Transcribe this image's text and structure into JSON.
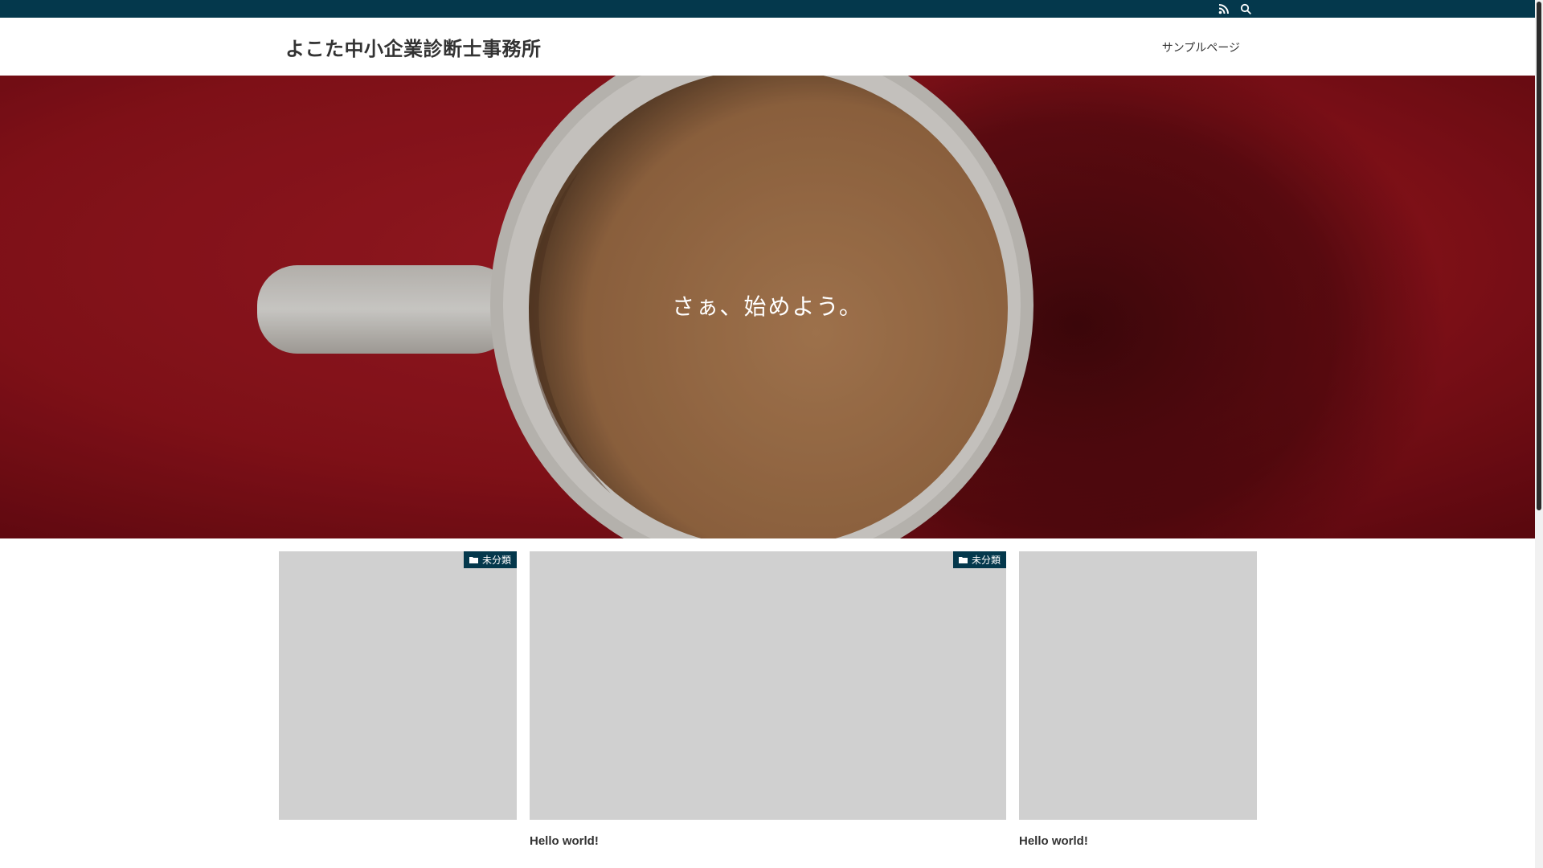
{
  "topbar": {
    "icons": [
      "rss-icon",
      "search-icon"
    ],
    "background": "#04384c"
  },
  "header": {
    "site_title": "よこた中小企業診断士事務所",
    "nav": [
      {
        "label": "サンプルページ"
      }
    ]
  },
  "hero": {
    "tagline": "さぁ、始めよう。"
  },
  "posts": [
    {
      "category": "未分類",
      "title": ""
    },
    {
      "category": "未分類",
      "title": "Hello world!"
    },
    {
      "category": "",
      "title": "Hello world!"
    }
  ],
  "colors": {
    "accent": "#04384c",
    "hero_red": "#a71a24",
    "placeholder": "#d0d0d0"
  }
}
